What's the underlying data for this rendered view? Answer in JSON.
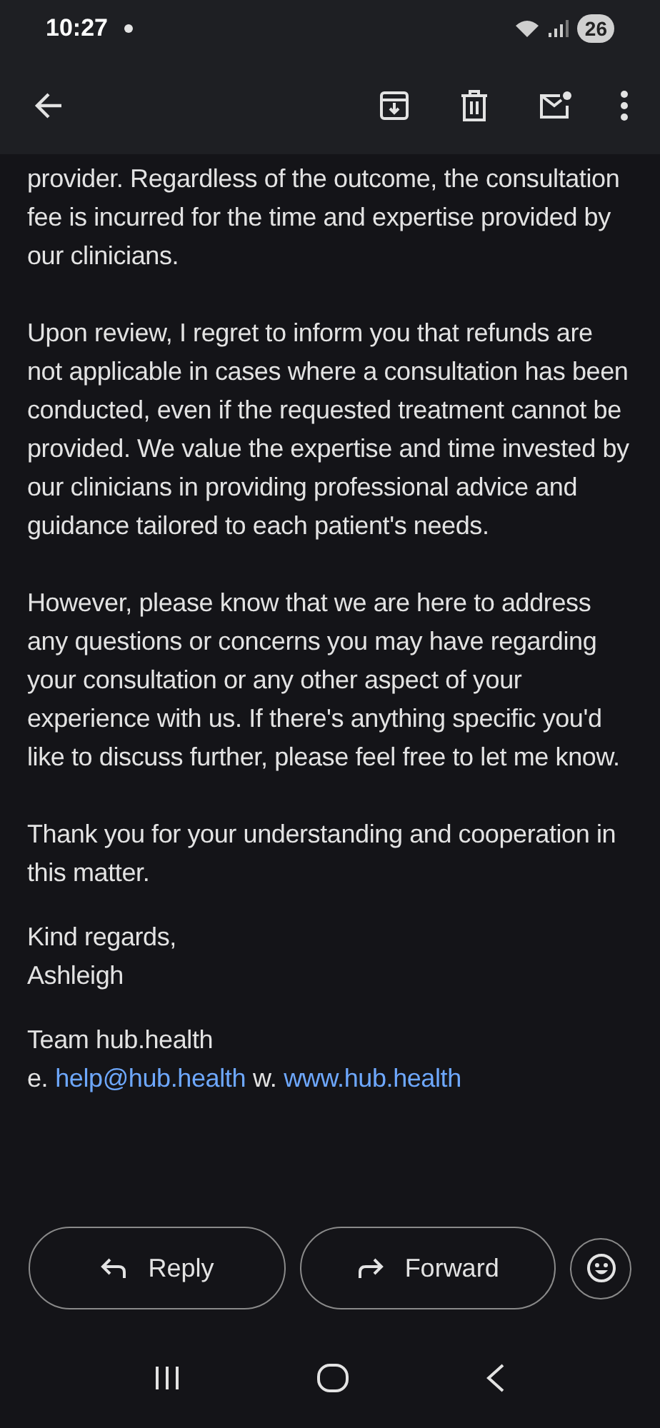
{
  "status_bar": {
    "time": "10:27",
    "battery": "26"
  },
  "paragraphs": [
    "provider. Regardless of the outcome, the consultation fee is incurred for the time and expertise provided by our clinicians.",
    "Upon review, I regret to inform you that refunds are not applicable in cases where a consultation has been conducted, even if the requested treatment cannot be provided. We value the expertise and time invested by our clinicians in providing professional advice and guidance tailored to each patient's needs.",
    "However, please know that we are here to address any questions or concerns you may have regarding your consultation or any other aspect of your experience with us. If there's anything specific you'd like to discuss further, please feel free to let me know.",
    "Thank you for your understanding and cooperation in this matter."
  ],
  "signoff": [
    "Kind regards,",
    "Ashleigh"
  ],
  "team": "Team hub.health",
  "contact": {
    "email_label": "e.",
    "email": "help@hub.health",
    "web_label": "w.",
    "web": "www.hub.health"
  },
  "actions": [
    {
      "kind": "reply",
      "label": "Reply"
    },
    {
      "kind": "forward",
      "label": "Forward"
    }
  ]
}
